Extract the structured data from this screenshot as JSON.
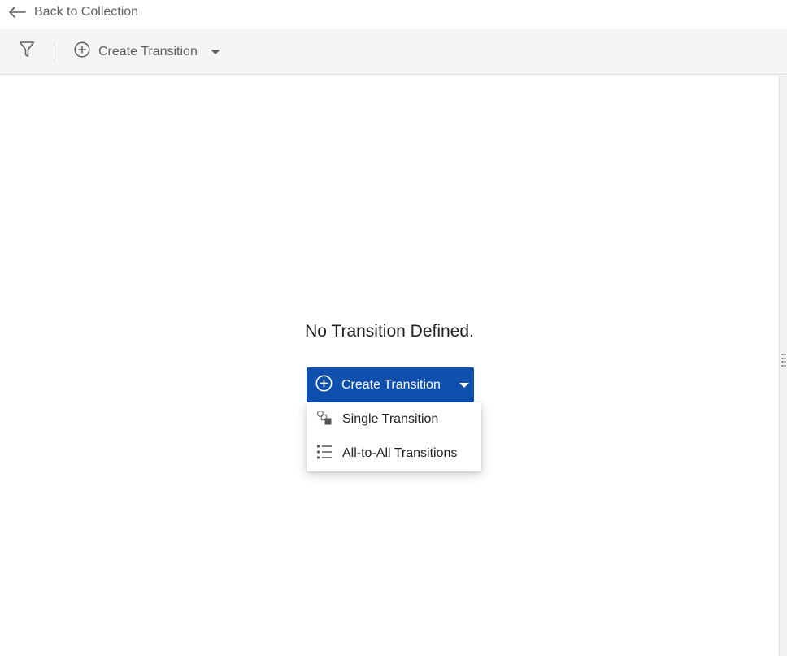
{
  "header": {
    "back_label": "Back to Collection",
    "back_icon": "arrow-left-icon"
  },
  "toolbar": {
    "filter_icon": "filter-icon",
    "create_label": "Create Transition",
    "create_icon": "plus-circle-icon",
    "dropdown_icon": "caret-down-icon"
  },
  "main": {
    "empty_message": "No Transition Defined.",
    "create_button_label": "Create Transition",
    "menu": {
      "items": [
        {
          "label": "Single Transition",
          "icon": "single-transition-icon"
        },
        {
          "label": "All-to-All Transitions",
          "icon": "list-icon"
        }
      ]
    }
  },
  "colors": {
    "primary": "#0f4fae",
    "toolbar_bg": "#f5f5f5",
    "muted_text": "#5f5f5f"
  }
}
